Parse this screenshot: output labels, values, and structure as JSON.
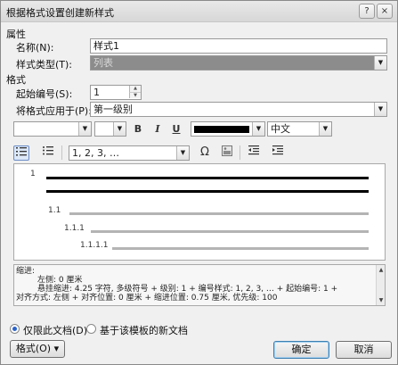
{
  "window": {
    "title": "根据格式设置创建新样式",
    "help_glyph": "?",
    "close_glyph": "×"
  },
  "properties": {
    "section": "属性",
    "name_label": "名称(N):",
    "name_value": "样式1",
    "type_label": "样式类型(T):",
    "type_value": "列表"
  },
  "format": {
    "section": "格式",
    "start_label": "起始编号(S):",
    "start_value": "1",
    "apply_label": "将格式应用于(P):",
    "apply_value": "第一级别"
  },
  "font_toolbar": {
    "font_value": "",
    "size_value": "",
    "bold": "B",
    "italic": "I",
    "underline": "U",
    "color": "#000000",
    "script_value": "中文"
  },
  "list_toolbar": {
    "number_style_value": "1, 2, 3, …",
    "symbol_glyph": "Ω"
  },
  "preview": {
    "levels": [
      "1",
      "1.1",
      "1.1.1",
      "1.1.1.1"
    ]
  },
  "description": {
    "lines": [
      "缩进:",
      "左侧:  0 厘米",
      "悬挂缩进:  4.25 字符, 多级符号 + 级别: 1 + 编号样式: 1, 2, 3, … + 起始编号: 1 +",
      "对齐方式: 左侧 + 对齐位置:  0 厘米 + 缩进位置:  0.75 厘米, 优先级: 100"
    ]
  },
  "scope": {
    "this_doc": "仅限此文档(D)",
    "template": "基于该模板的新文档"
  },
  "buttons": {
    "format": "格式(O) ▾",
    "ok": "确定",
    "cancel": "取消"
  }
}
